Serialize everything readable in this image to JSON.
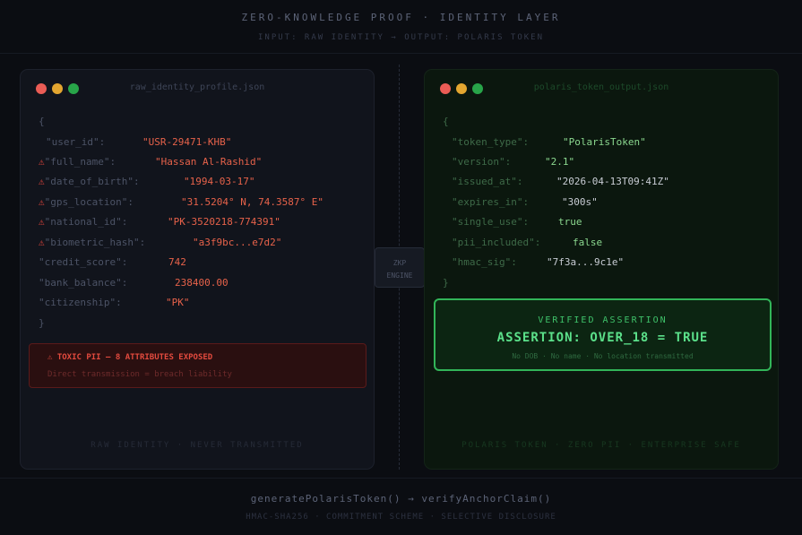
{
  "header": {
    "title": "ZERO-KNOWLEDGE PROOF · IDENTITY LAYER",
    "subtitle": "INPUT: RAW IDENTITY → OUTPUT: POLARIS TOKEN"
  },
  "left_panel": {
    "filename": "raw_identity_profile.json",
    "open_brace": "{",
    "close_brace": "}",
    "fields": [
      {
        "key": "\"user_id\":",
        "value": "\"USR-29471-KHB\"",
        "warn": false
      },
      {
        "key": "\"full_name\":",
        "value": "\"Hassan Al-Rashid\"",
        "warn": true
      },
      {
        "key": "\"date_of_birth\":",
        "value": "\"1994-03-17\"",
        "warn": true
      },
      {
        "key": "\"gps_location\":",
        "value": "\"31.5204° N, 74.3587° E\"",
        "warn": true
      },
      {
        "key": "\"national_id\":",
        "value": "\"PK-3520218-774391\"",
        "warn": true
      },
      {
        "key": "\"biometric_hash\":",
        "value": "\"a3f9bc...e7d2\"",
        "warn": true
      },
      {
        "key": "\"credit_score\":",
        "value": "742",
        "warn": false
      },
      {
        "key": "\"bank_balance\":",
        "value": "238400.00",
        "warn": false
      },
      {
        "key": "\"citizenship\":",
        "value": "\"PK\"",
        "warn": false
      }
    ],
    "warn_icon": "⚠",
    "toxic_title": "⚠ TOXIC PII — 8 ATTRIBUTES EXPOSED",
    "toxic_sub": "Direct transmission = breach liability",
    "footer": "RAW IDENTITY · NEVER TRANSMITTED"
  },
  "engine": {
    "line1": "ZKP",
    "line2": "ENGINE"
  },
  "right_panel": {
    "filename": "polaris_token_output.json",
    "open_brace": "{",
    "close_brace": "}",
    "fields": [
      {
        "key": "\"token_type\":",
        "value": "\"PolarisToken\"",
        "color": "green"
      },
      {
        "key": "\"version\":",
        "value": "\"2.1\"",
        "color": "green"
      },
      {
        "key": "\"issued_at\":",
        "value": "\"2026-04-13T09:41Z\"",
        "color": "white"
      },
      {
        "key": "\"expires_in\":",
        "value": "\"300s\"",
        "color": "white"
      },
      {
        "key": "\"single_use\":",
        "value": "true",
        "color": "green"
      },
      {
        "key": "\"pii_included\":",
        "value": "false",
        "color": "green"
      },
      {
        "key": "\"hmac_sig\":",
        "value": "\"7f3a...9c1e\"",
        "color": "white"
      }
    ],
    "verified_label": "VERIFIED ASSERTION",
    "assertion": "ASSERTION: OVER_18 = TRUE",
    "assertion_sub": "No DOB · No name · No location transmitted",
    "footer": "POLARIS TOKEN · ZERO PII · ENTERPRISE SAFE"
  },
  "footer": {
    "code": "generatePolarisToken() → verifyAnchorClaim()",
    "sub": "HMAC-SHA256 · COMMITMENT SCHEME · SELECTIVE DISCLOSURE"
  }
}
